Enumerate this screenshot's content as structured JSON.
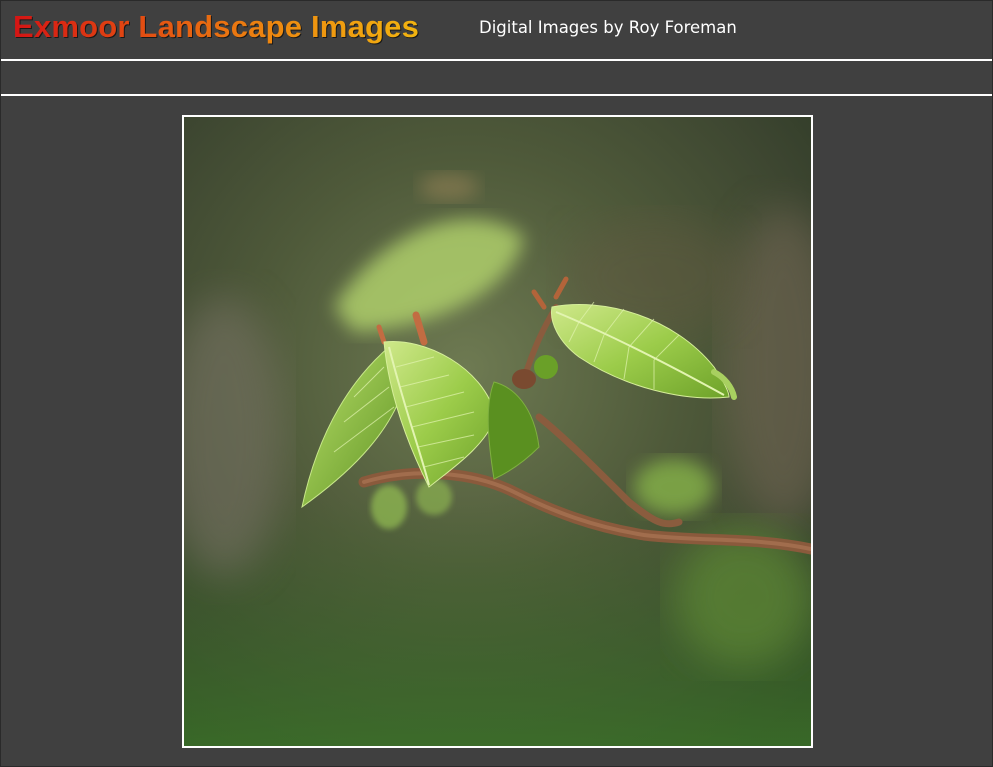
{
  "header": {
    "title": "Exmoor Landscape Images",
    "subtitle": "Digital Images by Roy Foreman"
  },
  "photo": {
    "subject": "leaf-icon"
  },
  "colors": {
    "background": "#404040",
    "title_gradient_start": "#d41414",
    "title_gradient_end": "#f2b410",
    "rule": "#ffffff"
  }
}
